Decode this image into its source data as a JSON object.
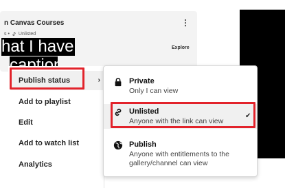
{
  "card": {
    "title": "n Canvas Courses",
    "meta_prefix": "s •",
    "meta_status": "Unlisted",
    "explore_label": "Explore",
    "kebab": "⋮"
  },
  "caption": {
    "line1": "hat I have",
    "line2": "caption"
  },
  "menu": {
    "items": [
      {
        "label": "Publish status",
        "chevron": "›"
      },
      {
        "label": "Add to playlist"
      },
      {
        "label": "Edit"
      },
      {
        "label": "Add to watch list"
      },
      {
        "label": "Analytics"
      }
    ]
  },
  "publish_options": [
    {
      "title": "Private",
      "desc": "Only I can view",
      "icon": "lock-icon"
    },
    {
      "title": "Unlisted",
      "desc": "Anyone with the link can view",
      "icon": "link-icon",
      "checkmark": "✔"
    },
    {
      "title": "Publish",
      "desc": "Anyone with entitlements to the gallery/channel can view",
      "icon": "globe-icon"
    }
  ],
  "colors": {
    "highlight_border": "#e2232b",
    "selected_bg": "#f0f0f0"
  }
}
